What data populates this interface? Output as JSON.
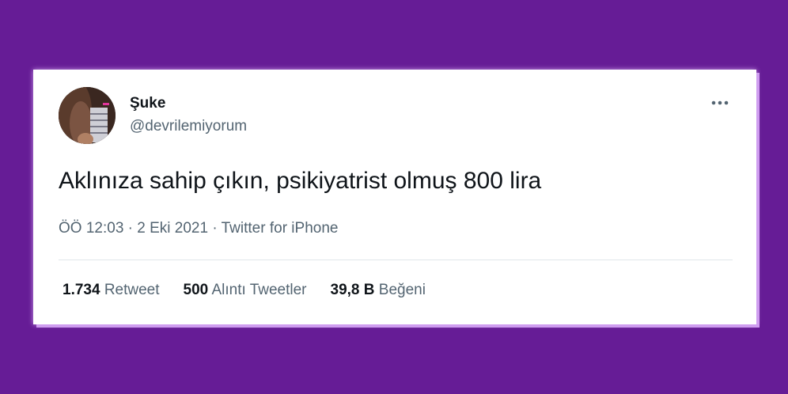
{
  "tweet": {
    "display_name": "Şuke",
    "handle": "@devrilemiyorum",
    "text": "Aklınıza sahip çıkın, psikiyatrist olmuş 800 lira",
    "time": "ÖÖ 12:03",
    "date": "2 Eki 2021",
    "separator": "·",
    "source": "Twitter for iPhone",
    "more_icon": "more-horizontal-icon"
  },
  "stats": [
    {
      "value": "1.734",
      "label": "Retweet"
    },
    {
      "value": "500",
      "label": "Alıntı Tweetler"
    },
    {
      "value": "39,8 B",
      "label": "Beğeni"
    }
  ],
  "colors": {
    "background": "#661c96",
    "card": "#ffffff",
    "primary_text": "#0f1419",
    "secondary_text": "#536471"
  }
}
